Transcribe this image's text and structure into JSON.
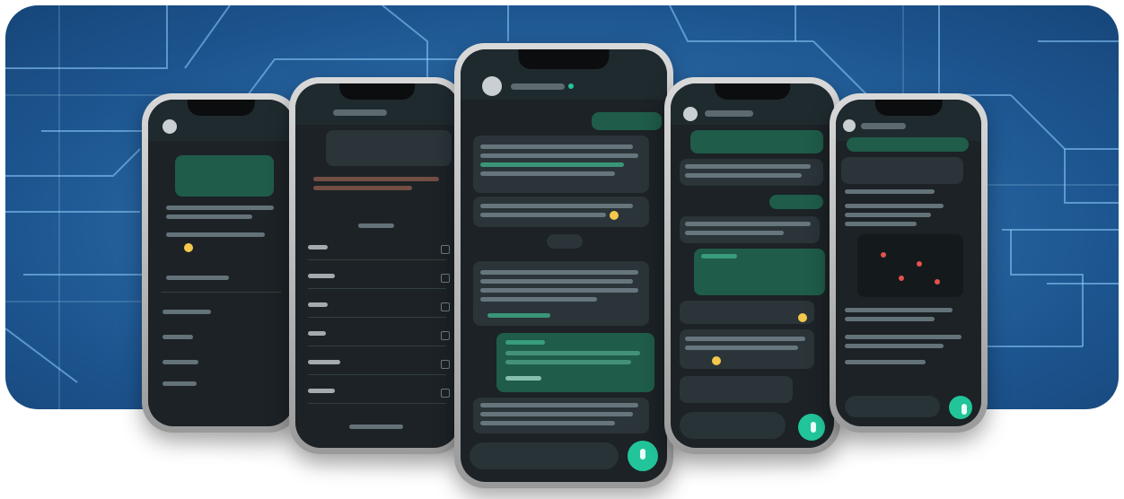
{
  "banner": {
    "phones": [
      {
        "name": "phone-far-left",
        "screen": "settings"
      },
      {
        "name": "phone-left",
        "screen": "contact-form"
      },
      {
        "name": "phone-center",
        "screen": "chat"
      },
      {
        "name": "phone-right",
        "screen": "chat"
      },
      {
        "name": "phone-far-right",
        "screen": "chat-map"
      }
    ],
    "colors": {
      "background_blue": "#2b6aa6",
      "grid_line": "#8fd0ff",
      "screen_dark": "#1c2226",
      "accent_green": "#22c59a",
      "outgoing_bubble": "#1f5c4a"
    },
    "icons": [
      "send-icon",
      "avatar-icon",
      "emoji-icon",
      "verified-badge-icon"
    ]
  }
}
